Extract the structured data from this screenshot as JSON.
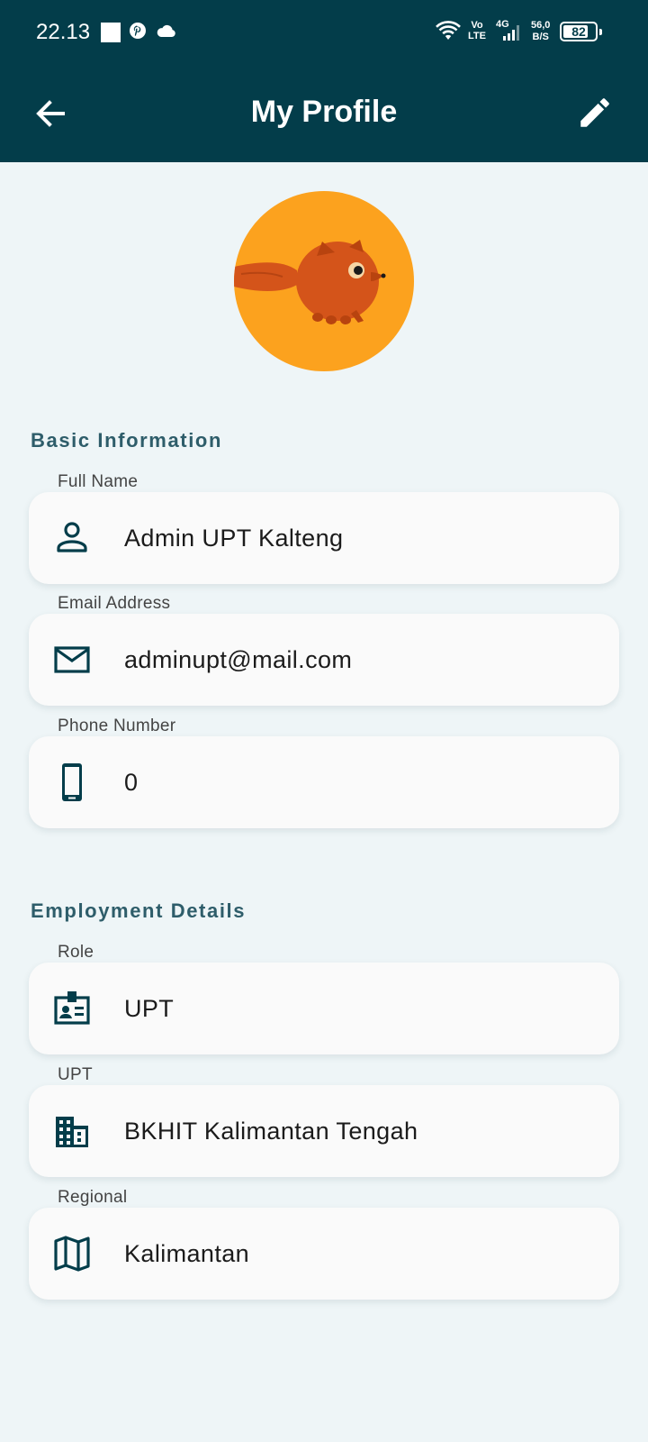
{
  "status_bar": {
    "time": "22.13",
    "volte_top": "Vo",
    "volte_bottom": "LTE",
    "network": "4G",
    "speed_top": "56,0",
    "speed_bottom": "B/S",
    "battery": "82",
    "battery_level": 0.82
  },
  "appbar": {
    "title": "My Profile",
    "back_icon": "arrow-back-icon",
    "edit_icon": "pencil-edit-icon"
  },
  "colors": {
    "header": "#033D4A",
    "background": "#EEF5F7",
    "section_title": "#2E5D6A",
    "icon": "#033D4A",
    "avatar_bg": "#FCA21E"
  },
  "basic_info": {
    "title": "Basic Information",
    "fields": [
      {
        "label": "Full Name",
        "value": "Admin UPT Kalteng",
        "icon": "person-icon"
      },
      {
        "label": "Email Address",
        "value": "adminupt@mail.com",
        "icon": "email-icon"
      },
      {
        "label": "Phone Number",
        "value": "0",
        "icon": "phone-icon"
      }
    ]
  },
  "employment": {
    "title": "Employment Details",
    "fields": [
      {
        "label": "Role",
        "value": "UPT",
        "icon": "id-badge-icon"
      },
      {
        "label": "UPT",
        "value": "BKHIT Kalimantan Tengah",
        "icon": "building-icon"
      },
      {
        "label": "Regional",
        "value": "Kalimantan",
        "icon": "map-icon"
      }
    ]
  }
}
